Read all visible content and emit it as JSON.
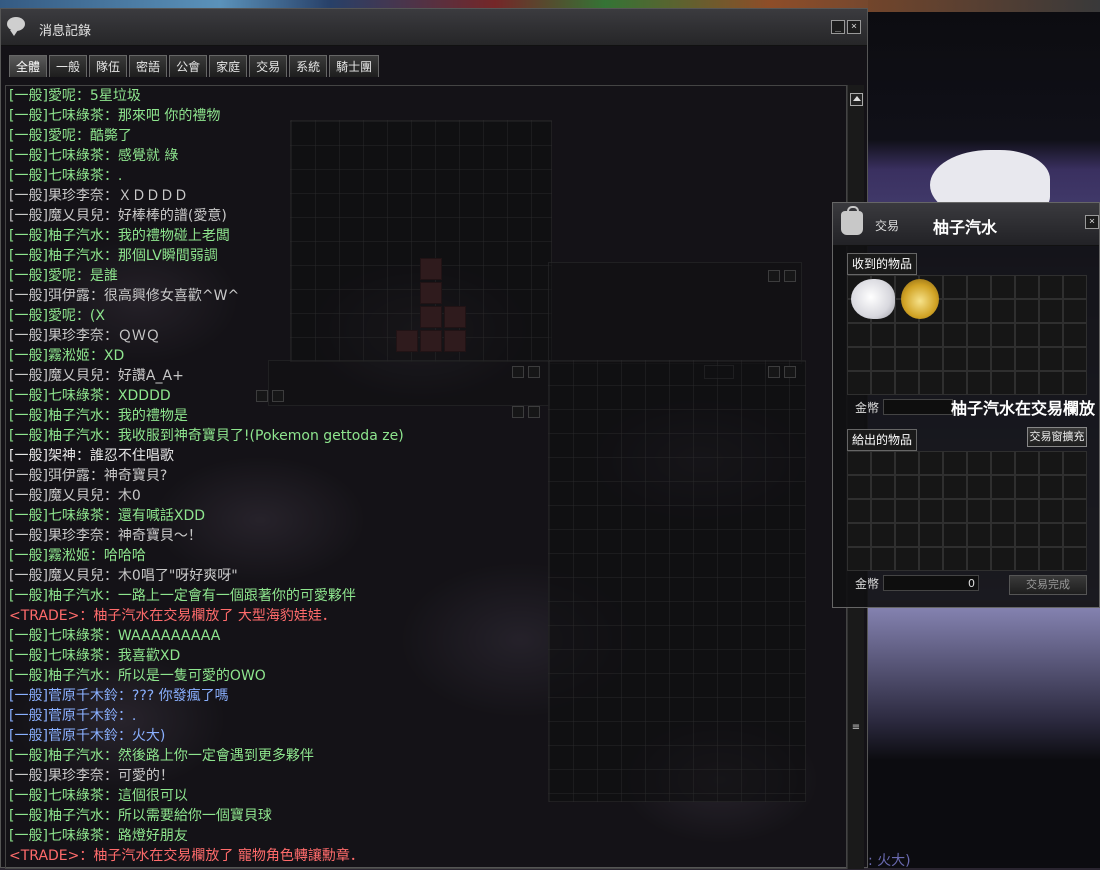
{
  "chat": {
    "title": "消息記錄",
    "tabs": [
      "全體",
      "一般",
      "隊伍",
      "密語",
      "公會",
      "家庭",
      "交易",
      "系統",
      "騎士團"
    ],
    "active_tab": 0,
    "messages": [
      {
        "tag": "[一般]",
        "name": "愛呢",
        "text": "：5星垃圾",
        "color": "#8ee58e"
      },
      {
        "tag": "[一般]",
        "name": "七味綠茶",
        "text": "：那來吧 你的禮物",
        "color": "#8ee58e"
      },
      {
        "tag": "[一般]",
        "name": "愛呢",
        "text": "：酷斃了",
        "color": "#8ee58e"
      },
      {
        "tag": "[一般]",
        "name": "七味綠茶",
        "text": "：感覺就 綠",
        "color": "#8ee58e"
      },
      {
        "tag": "[一般]",
        "name": "七味綠茶",
        "text": "：.",
        "color": "#8ee58e"
      },
      {
        "tag": "[一般]",
        "name": "果珍李奈",
        "text": "：ＸＤＤＤＤ",
        "color": "#c8c8c8"
      },
      {
        "tag": "[一般]",
        "name": "魔乂貝兒",
        "text": "：好棒棒的譜(愛意)",
        "color": "#c8c8c8"
      },
      {
        "tag": "[一般]",
        "name": "柚子汽水",
        "text": "：我的禮物碰上老闆",
        "color": "#8ee58e"
      },
      {
        "tag": "[一般]",
        "name": "柚子汽水",
        "text": "：那個LV瞬間弱調",
        "color": "#8ee58e"
      },
      {
        "tag": "[一般]",
        "name": "愛呢",
        "text": "：是誰",
        "color": "#8ee58e"
      },
      {
        "tag": "[一般]",
        "name": "弭伊露",
        "text": "：很高興修女喜歡^W^",
        "color": "#c8c8c8"
      },
      {
        "tag": "[一般]",
        "name": "愛呢",
        "text": "：(X",
        "color": "#8ee58e"
      },
      {
        "tag": "[一般]",
        "name": "果珍李奈",
        "text": "：ＱＷＱ",
        "color": "#c8c8c8"
      },
      {
        "tag": "[一般]",
        "name": "霧淞姬",
        "text": "：XD",
        "color": "#8ee58e"
      },
      {
        "tag": "[一般]",
        "name": "魔乂貝兒",
        "text": "：好讚A_A+",
        "color": "#c8c8c8"
      },
      {
        "tag": "[一般]",
        "name": "七味綠茶",
        "text": "：XDDDD",
        "color": "#8ee58e"
      },
      {
        "tag": "[一般]",
        "name": "柚子汽水",
        "text": "：我的禮物是",
        "color": "#8ee58e"
      },
      {
        "tag": "[一般]",
        "name": "柚子汽水",
        "text": "：我收服到神奇寶貝了!(Pokemon gettoda ze)",
        "color": "#8ee58e"
      },
      {
        "tag": "[一般]",
        "name": "架神",
        "text": "：誰忍不住唱歌",
        "color": "#e8e8e8"
      },
      {
        "tag": "[一般]",
        "name": "弭伊露",
        "text": "：神奇寶貝?",
        "color": "#c8c8c8"
      },
      {
        "tag": "[一般]",
        "name": "魔乂貝兒",
        "text": "：木0",
        "color": "#c8c8c8"
      },
      {
        "tag": "[一般]",
        "name": "七味綠茶",
        "text": "：還有喊話XDD",
        "color": "#8ee58e"
      },
      {
        "tag": "[一般]",
        "name": "果珍李奈",
        "text": "：神奇寶貝～！",
        "color": "#c8c8c8"
      },
      {
        "tag": "[一般]",
        "name": "霧淞姬",
        "text": "：哈哈哈",
        "color": "#8ee58e"
      },
      {
        "tag": "[一般]",
        "name": "魔乂貝兒",
        "text": "：木0唱了\"呀好爽呀\"",
        "color": "#c8c8c8"
      },
      {
        "tag": "[一般]",
        "name": "柚子汽水",
        "text": "：一路上一定會有一個跟著你的可愛夥伴",
        "color": "#8ee58e"
      },
      {
        "tag": "<TRADE>",
        "name": "",
        "text": "：柚子汽水在交易欄放了 大型海豹娃娃．",
        "color": "#ff6b6b"
      },
      {
        "tag": "[一般]",
        "name": "七味綠茶",
        "text": "：WAAAAAAAAA",
        "color": "#8ee58e"
      },
      {
        "tag": "[一般]",
        "name": "七味綠茶",
        "text": "：我喜歡XD",
        "color": "#8ee58e"
      },
      {
        "tag": "[一般]",
        "name": "柚子汽水",
        "text": "：所以是一隻可愛的OWO",
        "color": "#8ee58e"
      },
      {
        "tag": "[一般]",
        "name": "菅原千木鈴",
        "text": "：??? 你發瘋了嗎",
        "color": "#8ab0ff"
      },
      {
        "tag": "[一般]",
        "name": "菅原千木鈴",
        "text": "：.",
        "color": "#8ab0ff"
      },
      {
        "tag": "[一般]",
        "name": "菅原千木鈴",
        "text": "：火大)",
        "color": "#8ab0ff"
      },
      {
        "tag": "[一般]",
        "name": "柚子汽水",
        "text": "：然後路上你一定會遇到更多夥伴",
        "color": "#8ee58e"
      },
      {
        "tag": "[一般]",
        "name": "果珍李奈",
        "text": "：可愛的！",
        "color": "#c8c8c8"
      },
      {
        "tag": "[一般]",
        "name": "七味綠茶",
        "text": "：這個很可以",
        "color": "#8ee58e"
      },
      {
        "tag": "[一般]",
        "name": "柚子汽水",
        "text": "：所以需要給你一個寶貝球",
        "color": "#8ee58e"
      },
      {
        "tag": "[一般]",
        "name": "七味綠茶",
        "text": "：路燈好朋友",
        "color": "#8ee58e"
      },
      {
        "tag": "<TRADE>",
        "name": "",
        "text": "：柚子汽水在交易欄放了 寵物角色轉讓勳章．",
        "color": "#ff6b6b"
      }
    ],
    "minimize_icon": "minimize-icon",
    "close_icon": "close-icon"
  },
  "trade": {
    "label": "交易",
    "partner": "柚子汽水",
    "received_label": "收到的物品",
    "given_label": "給出的物品",
    "money_label": "金幣",
    "notice": "柚子汽水在交易欄放",
    "expand_button": "交易窗擴充",
    "complete_button": "交易完成",
    "given_money": "0",
    "received_items": [
      "seal-plush-icon",
      "pet-transfer-medal-icon"
    ]
  },
  "scroll_marker": "≡",
  "bottom_partial": ": 火大)"
}
